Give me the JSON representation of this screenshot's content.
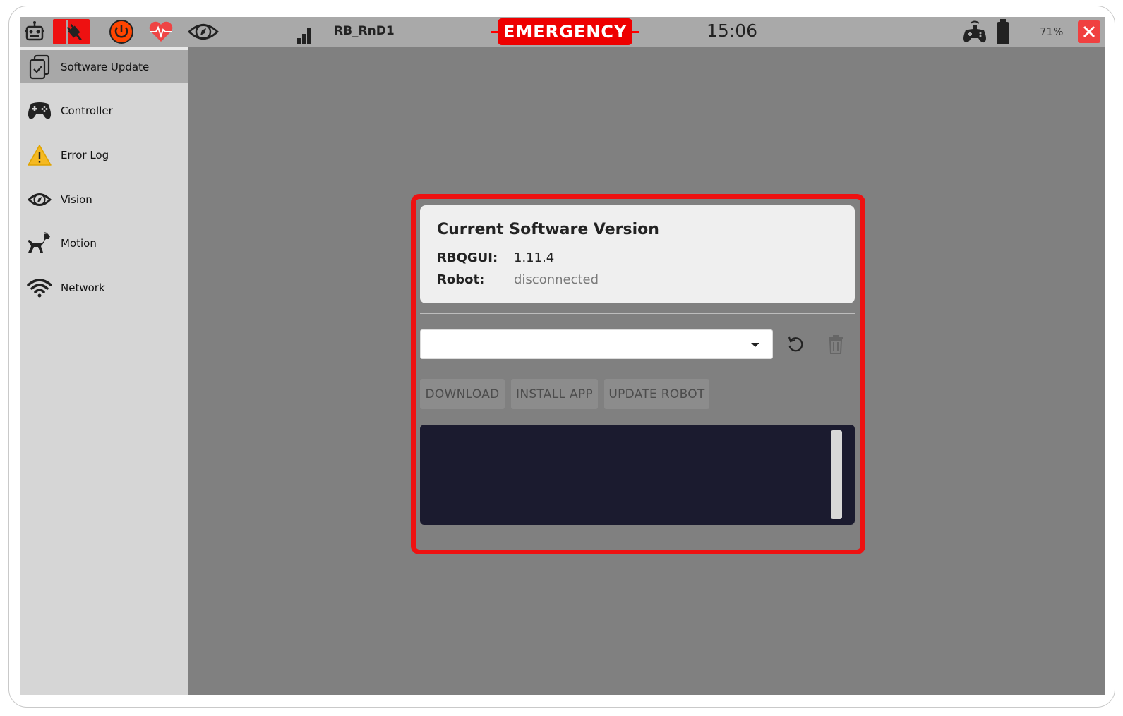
{
  "topbar": {
    "robot_name": "RB_RnD1",
    "emergency_label": "EMERGENCY",
    "clock": "15:06",
    "battery_percent": "71%",
    "signal_bars": 3,
    "icons": [
      "robot-icon",
      "disconnected-plug-icon",
      "power-icon",
      "heartbeat-icon",
      "vision-eye-icon",
      "signal-icon",
      "gamepad-icon",
      "battery-icon",
      "close-icon"
    ],
    "colors": {
      "emergency": "#ee0000",
      "close": "#f04040",
      "power": "#ff4500",
      "heartbeat": "#ef4444"
    }
  },
  "sidebar": {
    "items": [
      {
        "label": "Software Update",
        "icon": "software-update-icon",
        "active": true
      },
      {
        "label": "Controller",
        "icon": "gamepad-icon"
      },
      {
        "label": "Error Log",
        "icon": "warning-icon"
      },
      {
        "label": "Vision",
        "icon": "eye-icon"
      },
      {
        "label": "Motion",
        "icon": "dog-robot-icon"
      },
      {
        "label": "Network",
        "icon": "wifi-icon"
      }
    ]
  },
  "software_update": {
    "title": "Current Software Version",
    "rbqgui_label": "RBQGUI:",
    "rbqgui_value": "1.11.4",
    "robot_label": "Robot:",
    "robot_value": "disconnected",
    "version_select_value": "",
    "buttons": {
      "download": "DOWNLOAD",
      "install": "INSTALL APP",
      "update": "UPDATE ROBOT"
    },
    "console_text": ""
  }
}
